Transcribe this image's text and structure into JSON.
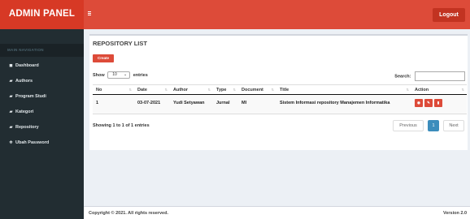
{
  "header": {
    "logo": "ADMIN PANEL",
    "logout_label": "Logout"
  },
  "sidebar": {
    "heading": "MAIN NAVIGATION",
    "items": [
      {
        "label": "Dashboard",
        "icon": "dashboard-icon",
        "glyph": "◼"
      },
      {
        "label": "Authors",
        "icon": "book-icon",
        "glyph": "▰"
      },
      {
        "label": "Program Studi",
        "icon": "book-icon",
        "glyph": "▰"
      },
      {
        "label": "Kategori",
        "icon": "book-icon",
        "glyph": "▰"
      },
      {
        "label": "Repository",
        "icon": "book-icon",
        "glyph": "▰"
      },
      {
        "label": "Ubah Password",
        "icon": "gear-icon",
        "glyph": "✲"
      }
    ]
  },
  "panel": {
    "title": "REPOSITORY LIST",
    "create_label": "Create",
    "show_label": "Show",
    "show_value": "10",
    "entries_label": "entries",
    "search_label": "Search:",
    "search_value": ""
  },
  "table": {
    "columns": [
      "No",
      "Date",
      "Author",
      "Type",
      "Document",
      "Title",
      "Action"
    ],
    "rows": [
      {
        "no": "1",
        "date": "03-07-2021",
        "author": "Yudi Setyawan",
        "type": "Jurnal",
        "document": "MI",
        "title": "Sistem Informasi repository Manajemen Informatika"
      }
    ]
  },
  "pagination": {
    "info": "Showing 1 to 1 of 1 entries",
    "previous": "Previous",
    "current": "1",
    "next": "Next"
  },
  "footer": {
    "copyright": "Copyright © 2021. All rights reserved.",
    "version": "Version 2.0"
  },
  "colors": {
    "brand": "#dd4b39",
    "sidebar": "#222d32",
    "active_page": "#3c8dbc"
  }
}
